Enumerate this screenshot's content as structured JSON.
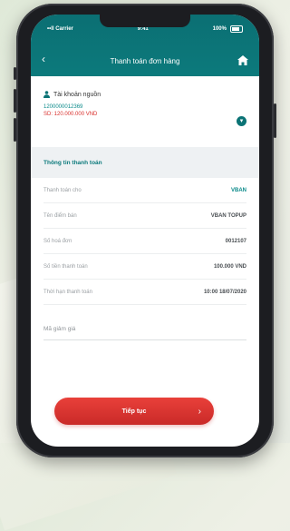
{
  "status": {
    "carrier": "••ll Carrier",
    "time": "9:41",
    "battery": "100%"
  },
  "nav": {
    "back_icon": "chevron-left-icon",
    "title": "Thanh toán đơn hàng",
    "home_icon": "home-icon"
  },
  "account": {
    "label": "Tài khoản nguồn",
    "number": "1200000012369",
    "balance": "SD: 120.000.000 VND"
  },
  "section_title": "Thông tin thanh toán",
  "details": [
    {
      "label": "Thanh toán cho",
      "value": "VBAN"
    },
    {
      "label": "Tên điểm bán",
      "value": "VBAN TOPUP"
    },
    {
      "label": "Số hoá đơn",
      "value": "0012107"
    },
    {
      "label": "Số tiền thanh toán",
      "value": "100.000 VND"
    },
    {
      "label": "Thời hạn thanh toán",
      "value": "10:00 18/07/2020"
    }
  ],
  "promo_placeholder": "Mã giảm giá",
  "continue_label": "Tiếp tục",
  "colors": {
    "primary": "#0b7375",
    "accent": "#e33a35"
  }
}
